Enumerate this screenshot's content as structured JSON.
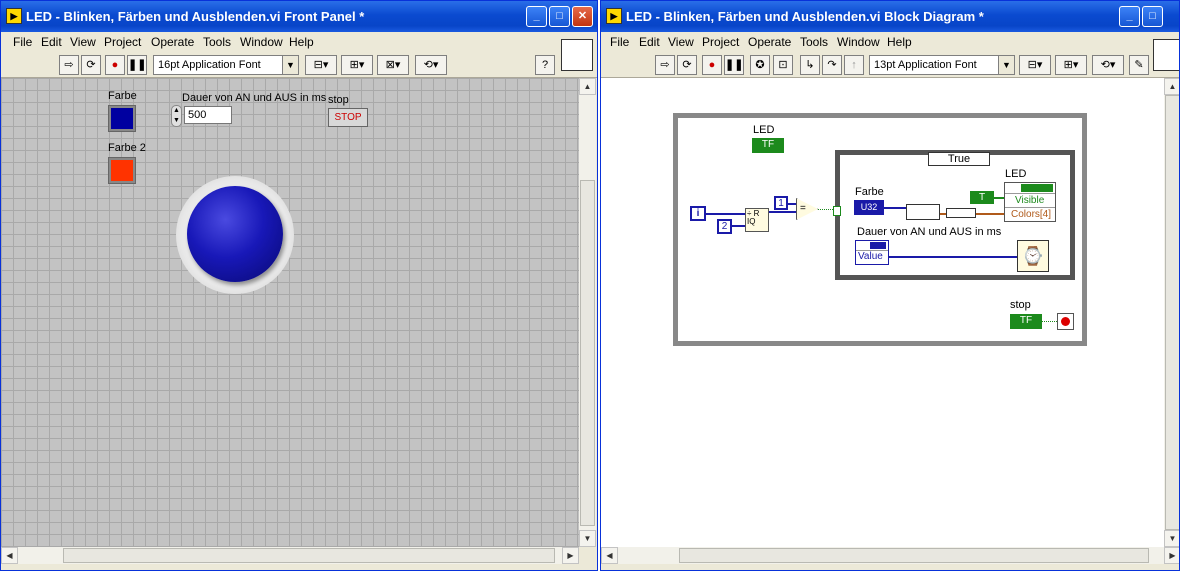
{
  "front_panel": {
    "title": "LED - Blinken, Färben und Ausblenden.vi Front Panel *",
    "menu": [
      "File",
      "Edit",
      "View",
      "Project",
      "Operate",
      "Tools",
      "Window",
      "Help"
    ],
    "font": "16pt Application Font",
    "controls": {
      "farbe_label": "Farbe",
      "farbe_color": "#0000a0",
      "farbe2_label": "Farbe 2",
      "farbe2_color": "#ff3300",
      "dauer_label": "Dauer von AN und AUS in ms",
      "dauer_value": "500",
      "stop_label": "stop",
      "stop_button": "STOP"
    }
  },
  "block_diagram": {
    "title": "LED - Blinken, Färben und Ausblenden.vi Block Diagram *",
    "menu": [
      "File",
      "Edit",
      "View",
      "Project",
      "Operate",
      "Tools",
      "Window",
      "Help"
    ],
    "font": "13pt Application Font",
    "nodes": {
      "led_label": "LED",
      "tf": "TF",
      "iteration": "i",
      "const_2": "2",
      "const_1": "1",
      "quotient": "÷ R IQ",
      "equal": "=",
      "case_selector": "True",
      "farbe_label": "Farbe",
      "u32": "U32",
      "bool_const": "T",
      "led_prop_label": "LED",
      "prop_visible": "Visible",
      "prop_colors": "Colors[4]",
      "dauer_label": "Dauer von AN und AUS in ms",
      "value_prop": "Value",
      "stop_label": "stop"
    }
  }
}
